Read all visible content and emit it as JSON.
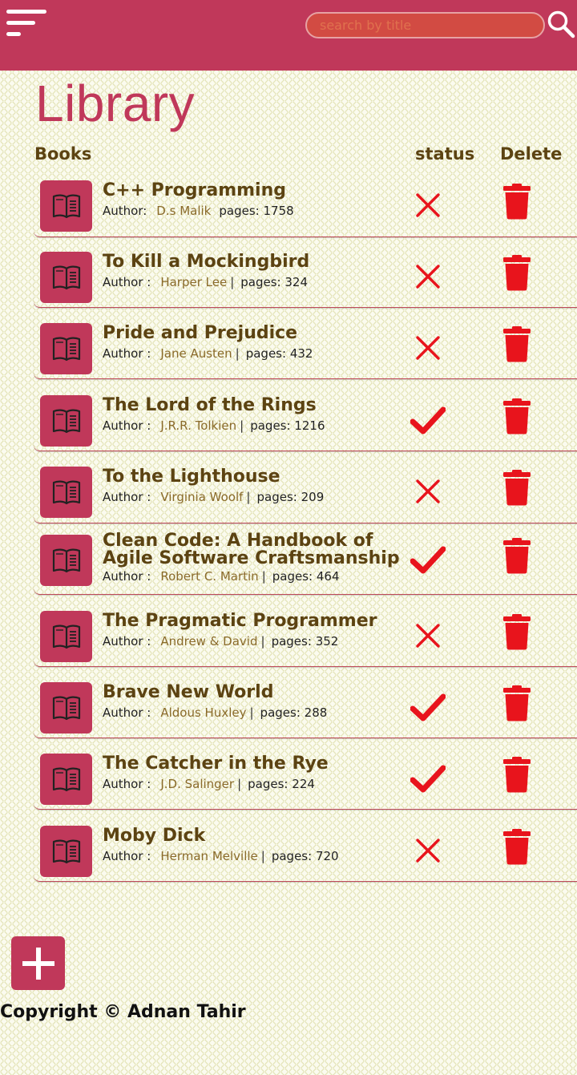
{
  "header": {
    "search_placeholder": "search by title",
    "menu_icon": "hamburger-menu-icon",
    "search_icon": "magnifier-icon",
    "bar_color": "#c0385a"
  },
  "page": {
    "title": "Library"
  },
  "columns": {
    "books": "Books",
    "status": "status",
    "delete": "Delete"
  },
  "labels": {
    "author": "Author :",
    "author_first": "Author:",
    "pages_prefix": "pages:"
  },
  "books": [
    {
      "title": "C++ Programming",
      "author": "D.s Malik",
      "pages": "1758",
      "status": "unread"
    },
    {
      "title": "To Kill a Mockingbird",
      "author": "Harper Lee",
      "pages": "324",
      "status": "unread"
    },
    {
      "title": "Pride and Prejudice",
      "author": "Jane Austen",
      "pages": "432",
      "status": "unread"
    },
    {
      "title": "The Lord of the Rings",
      "author": "J.R.R. Tolkien",
      "pages": "1216",
      "status": "read"
    },
    {
      "title": "To the Lighthouse",
      "author": "Virginia Woolf",
      "pages": "209",
      "status": "unread"
    },
    {
      "title": "Clean Code: A Handbook of Agile Software Craftsmanship",
      "author": "Robert C. Martin",
      "pages": "464",
      "status": "read"
    },
    {
      "title": "The Pragmatic Programmer",
      "author": "Andrew & David",
      "pages": "352",
      "status": "unread"
    },
    {
      "title": "Brave New World",
      "author": "Aldous Huxley",
      "pages": "288",
      "status": "read"
    },
    {
      "title": "The Catcher in the Rye",
      "author": "J.D. Salinger",
      "pages": "224",
      "status": "read"
    },
    {
      "title": "Moby Dick",
      "author": "Herman Melville",
      "pages": "720",
      "status": "unread"
    }
  ],
  "icons": {
    "book": "open-book-icon",
    "read": "check-icon",
    "unread": "cross-icon",
    "delete": "trash-icon",
    "add": "plus-icon"
  },
  "colors": {
    "accent": "#c0385a",
    "status_red": "#e8141c",
    "title_brown": "#5c4312"
  },
  "footer": {
    "copyright": "Copyright © Adnan Tahir"
  }
}
